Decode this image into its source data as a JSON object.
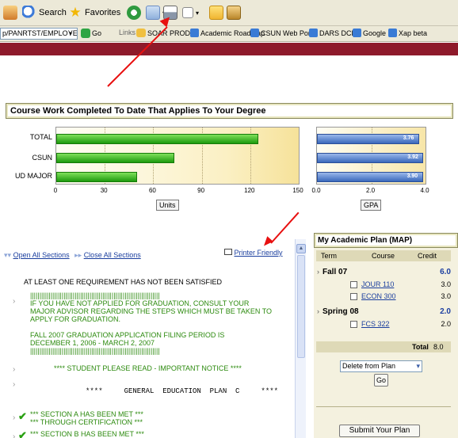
{
  "toolbar": {
    "search_label": "Search",
    "favorites_label": "Favorites"
  },
  "links_bar": {
    "address_value": "p/PANRTST/EMPLOYEE,",
    "go_label": "Go",
    "links_label": "Links",
    "links": [
      "SOAR PROD",
      "Academic Roadmap",
      "CSUN Web Portal",
      "DARS DCP",
      "Google",
      "Xap beta"
    ]
  },
  "course_work": {
    "title": "Course Work Completed To Date That Applies To Your Degree",
    "units_axis_label": "Units",
    "gpa_axis_label": "GPA"
  },
  "chart_data": [
    {
      "type": "bar",
      "orientation": "horizontal",
      "categories": [
        "TOTAL",
        "CSUN",
        "UD MAJOR"
      ],
      "values": [
        125,
        73,
        50
      ],
      "xlabel": "Units",
      "xlim": [
        0,
        150
      ],
      "xticks": [
        "0",
        "30",
        "60",
        "90",
        "120",
        "150"
      ],
      "color": "#22b10f"
    },
    {
      "type": "bar",
      "orientation": "horizontal",
      "categories": [
        "TOTAL",
        "CSUN",
        "UD MAJOR"
      ],
      "values": [
        3.76,
        3.92,
        3.9
      ],
      "data_labels": [
        "3.76",
        "3.92",
        "3.90"
      ],
      "xlabel": "GPA",
      "xlim": [
        0,
        4.0
      ],
      "xticks": [
        "0.0",
        "2.0",
        "4.0"
      ],
      "color": "#4a78c8"
    }
  ],
  "requirements": {
    "open_all": "Open All Sections",
    "close_all": "Close All Sections",
    "printer_friendly": "Printer Friendly",
    "status": "AT LEAST ONE REQUIREMENT HAS NOT BEEN SATISFIED",
    "bars_line": "||||||||||||||||||||||||||||||||||||||||||||||||||||||||||||||||||||||",
    "notice_lines": [
      "IF YOU HAVE NOT APPLIED FOR GRADUATION, CONSULT YOUR",
      "MAJOR ADVISOR REGARDING THE STEPS WHICH MUST BE TAKEN TO",
      "APPLY FOR GRADUATION."
    ],
    "period_lines": [
      "FALL 2007 GRADUATION APPLICATION FILING PERIOD IS",
      "DECEMBER 1, 2006 - MARCH 2, 2007"
    ],
    "important_notice": "**** STUDENT PLEASE READ - IMPORTANT NOTICE ****",
    "ge_plan": "****     GENERAL  EDUCATION  PLAN  C     ****",
    "section_a": [
      "*** SECTION A HAS BEEN MET ***",
      "*** THROUGH CERTIFICATION ***"
    ],
    "section_b": "*** SECTION B HAS BEEN MET ***"
  },
  "plan": {
    "title": "My Academic Plan (MAP)",
    "headers": {
      "term": "Term",
      "course": "Course",
      "credit": "Credit"
    },
    "terms": [
      {
        "name": "Fall 07",
        "credit": "6.0",
        "courses": [
          {
            "code": "JOUR 110",
            "credit": "3.0"
          },
          {
            "code": "ECON 300",
            "credit": "3.0"
          }
        ]
      },
      {
        "name": "Spring 08",
        "credit": "2.0",
        "courses": [
          {
            "code": "FCS 322",
            "credit": "2.0"
          }
        ]
      }
    ],
    "total_label": "Total",
    "total_value": "8.0",
    "action_select": "Delete from Plan",
    "go_button": "Go",
    "submit_button": "Submit Your Plan"
  }
}
